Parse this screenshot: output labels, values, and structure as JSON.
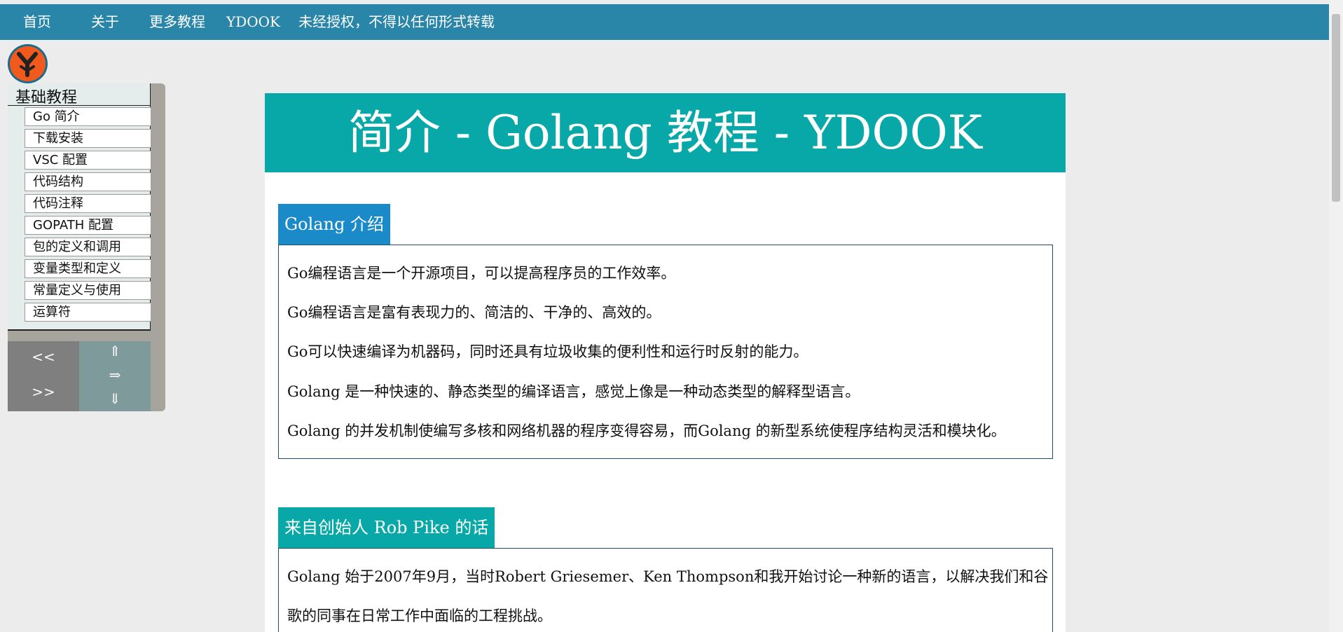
{
  "nav": {
    "items": [
      "首页",
      "关于",
      "更多教程",
      "YDOOK",
      "未经授权，不得以任何形式转载"
    ]
  },
  "logo": {
    "letter": "Y",
    "color": "#f25a1d"
  },
  "sidebar": {
    "title": "基础教程",
    "items": [
      "Go 简介",
      "下载安装",
      "VSC 配置",
      "代码结构",
      "代码注释",
      "GOPATH 配置",
      "包的定义和调用",
      "变量类型和定义",
      "常量定义与使用",
      "运算符"
    ],
    "pager": {
      "prev": "<<",
      "next": ">>"
    },
    "arrows": {
      "up": "⇑",
      "right": "⇒",
      "down": "⇓"
    }
  },
  "main": {
    "title": "简介 - Golang 教程 - YDOOK",
    "sections": [
      {
        "heading": "Golang 介绍",
        "heading_color": "#1a8ac9",
        "paragraphs": [
          "Go编程语言是一个开源项目，可以提高程序员的工作效率。",
          "Go编程语言是富有表现力的、简洁的、干净的、高效的。",
          "Go可以快速编译为机器码，同时还具有垃圾收集的便利性和运行时反射的能力。",
          "Golang 是一种快速的、静态类型的编译语言，感觉上像是一种动态类型的解释型语言。",
          "Golang 的并发机制使编写多核和网络机器的程序变得容易，而Golang 的新型系统使程序结构灵活和模块化。"
        ]
      },
      {
        "heading": "来自创始人 Rob Pike 的话",
        "heading_color": "#09a8a8",
        "paragraphs": [
          "Golang 始于2007年9月，当时Robert Griesemer、Ken Thompson和我开始讨论一种新的语言，以解决我们和谷",
          "歌的同事在日常工作中面临的工程挑战。"
        ]
      }
    ]
  }
}
